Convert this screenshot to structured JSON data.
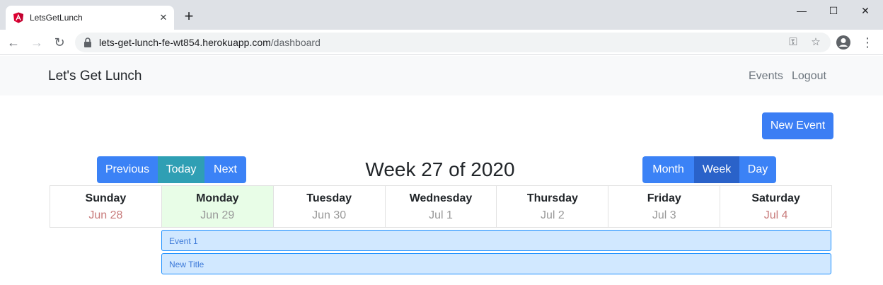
{
  "browser": {
    "tab_title": "LetsGetLunch",
    "tab_close": "✕",
    "new_tab": "+",
    "url_host": "lets-get-lunch-fe-wt854.herokuapp.com",
    "url_path": "/dashboard",
    "window_controls": {
      "minimize": "—",
      "maximize": "☐",
      "close": "✕"
    },
    "icons": [
      "back-icon",
      "forward-icon",
      "reload-icon",
      "lock-icon",
      "key-icon",
      "star-icon",
      "profile-icon",
      "menu-icon"
    ]
  },
  "navbar": {
    "brand": "Let's Get Lunch",
    "links": {
      "events": "Events",
      "logout": "Logout"
    }
  },
  "actions": {
    "new_event": "New Event"
  },
  "calendar": {
    "nav": {
      "previous": "Previous",
      "today": "Today",
      "next": "Next"
    },
    "title": "Week 27 of 2020",
    "views": {
      "month": "Month",
      "week": "Week",
      "day": "Day"
    },
    "active_view": "Week",
    "days": [
      {
        "name": "Sunday",
        "date": "Jun 28"
      },
      {
        "name": "Monday",
        "date": "Jun 29"
      },
      {
        "name": "Tuesday",
        "date": "Jun 30"
      },
      {
        "name": "Wednesday",
        "date": "Jul 1"
      },
      {
        "name": "Thursday",
        "date": "Jul 2"
      },
      {
        "name": "Friday",
        "date": "Jul 3"
      },
      {
        "name": "Saturday",
        "date": "Jul 4"
      }
    ],
    "events": [
      {
        "title": "Event 1"
      },
      {
        "title": "New Title"
      }
    ]
  },
  "colors": {
    "primary": "#3b82f6",
    "today_button": "#2f9fb4",
    "active_view": "#2a62c9",
    "today_column": "#e8fde7",
    "event_bg": "#d1e8ff",
    "event_border": "#1e90ff"
  }
}
